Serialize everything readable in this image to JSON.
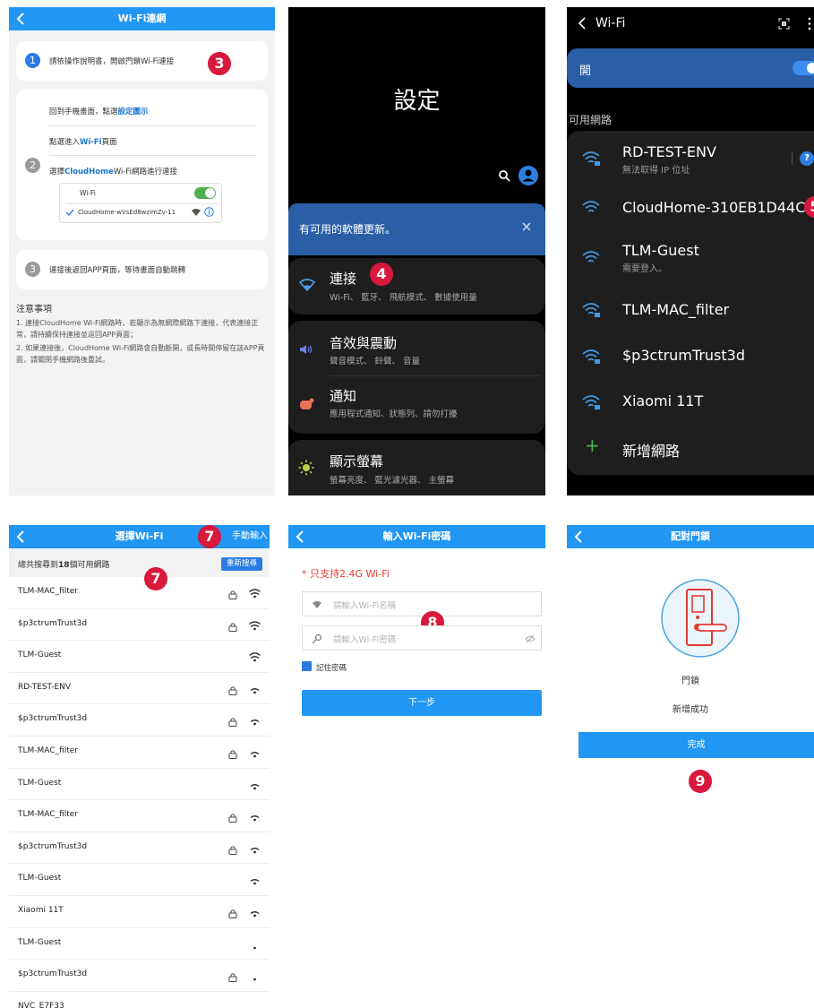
{
  "colors": {
    "app_blue": "#2196f3",
    "accent_blue": "#2a7de1",
    "step_marker_red": "#d8183c",
    "android_dark": "#000000",
    "android_card": "#1e1e1e",
    "android_blue": "#2a5fa8"
  },
  "markers": [
    "3",
    "4",
    "5",
    "7",
    "7",
    "8",
    "9"
  ],
  "panel_guide": {
    "title": "Wi-Fi連網",
    "step1": "請依操作說明書，開啟門鎖Wi-Fi連接",
    "step2_line1_prefix": "回到手機畫面，點選",
    "step2_line1_link": "設定圖示",
    "step2_line2_prefix": "點選進入",
    "step2_line2_link": "Wi-Fi",
    "step2_line2_suffix": "頁面",
    "step2_line3_prefix": "選擇",
    "step2_line3_link": "CloudHome",
    "step2_line3_suffix": "Wi-Fi網路進行連接",
    "mini_wifi_label": "Wi-Fi",
    "mini_network": "CloudHome-wVsEd8wzimZv-11",
    "step3": "連接後返回APP頁面，等待畫面自動跳轉",
    "notes_title": "注意事項",
    "note1": "1. 連接CloudHome Wi-Fi網路時，若顯示為無網際網路下連接，代表連接正常，請持續保持連接並返回APP頁面；",
    "note2": "2. 如果連接後，CloudHome Wi-Fi網路會自動斷開，或長時間停留在該APP頁面，請關閉手機網路後重試。",
    "step_numbers": [
      "1",
      "2",
      "3"
    ]
  },
  "panel_settings": {
    "title": "設定",
    "update_banner": "有可用的軟體更新。",
    "items": [
      {
        "title": "連接",
        "subtitle": "Wi-Fi、 藍牙、 飛航模式、 數據使用量"
      },
      {
        "title": "音效與震動",
        "subtitle": "聲音模式、 鈴聲、 音量"
      },
      {
        "title": "通知",
        "subtitle": "應用程式通知、狀態列、請勿打擾"
      },
      {
        "title": "顯示螢幕",
        "subtitle": "螢幕亮度、 藍光濾光器、 主螢幕"
      }
    ]
  },
  "panel_wifi_android": {
    "title": "Wi-Fi",
    "open_label": "開",
    "section_label": "可用網路",
    "networks": [
      {
        "name": "RD-TEST-ENV",
        "sub": "無法取得 IP 位址"
      },
      {
        "name": "CloudHome-310EB1D44C",
        "sub": ""
      },
      {
        "name": "TLM-Guest",
        "sub": "需要登入。"
      },
      {
        "name": "TLM-MAC_filter",
        "sub": ""
      },
      {
        "name": "$p3ctrumTrust3d",
        "sub": ""
      },
      {
        "name": "Xiaomi 11T",
        "sub": ""
      }
    ],
    "add_network": "新增網路",
    "help_badge": "?"
  },
  "panel_select_wifi": {
    "title": "選擇Wi-Fi",
    "manual": "手動輸入",
    "found_prefix": "總共搜尋到",
    "found_count": "18",
    "found_suffix": "個可用網路",
    "rescan": "重新搜尋",
    "networks": [
      {
        "name": "TLM-MAC_filter",
        "locked": true,
        "signal": 3
      },
      {
        "name": "$p3ctrumTrust3d",
        "locked": true,
        "signal": 3
      },
      {
        "name": "TLM-Guest",
        "locked": false,
        "signal": 3
      },
      {
        "name": "RD-TEST-ENV",
        "locked": true,
        "signal": 2
      },
      {
        "name": "$p3ctrumTrust3d",
        "locked": true,
        "signal": 2
      },
      {
        "name": "TLM-MAC_filter",
        "locked": true,
        "signal": 2
      },
      {
        "name": "TLM-Guest",
        "locked": false,
        "signal": 2
      },
      {
        "name": "TLM-MAC_filter",
        "locked": true,
        "signal": 2
      },
      {
        "name": "$p3ctrumTrust3d",
        "locked": true,
        "signal": 2
      },
      {
        "name": "TLM-Guest",
        "locked": false,
        "signal": 2
      },
      {
        "name": "Xiaomi 11T",
        "locked": true,
        "signal": 2
      },
      {
        "name": "TLM-Guest",
        "locked": false,
        "signal": 1
      },
      {
        "name": "$p3ctrumTrust3d",
        "locked": true,
        "signal": 1
      },
      {
        "name": "NVC_E7F33",
        "locked": false,
        "signal": 1
      }
    ]
  },
  "panel_password": {
    "title": "輸入Wi-Fi密碼",
    "warning": "* 只支持2.4G Wi-Fi",
    "ssid_placeholder": "請輸入Wi-Fi名稱",
    "password_placeholder": "請輸入Wi-Fi密碼",
    "remember_label": "記住密碼",
    "remember_checked": true,
    "next_button": "下一步"
  },
  "panel_pair": {
    "title": "配對門鎖",
    "device_name": "門鎖",
    "status": "新增成功",
    "done_button": "完成"
  }
}
